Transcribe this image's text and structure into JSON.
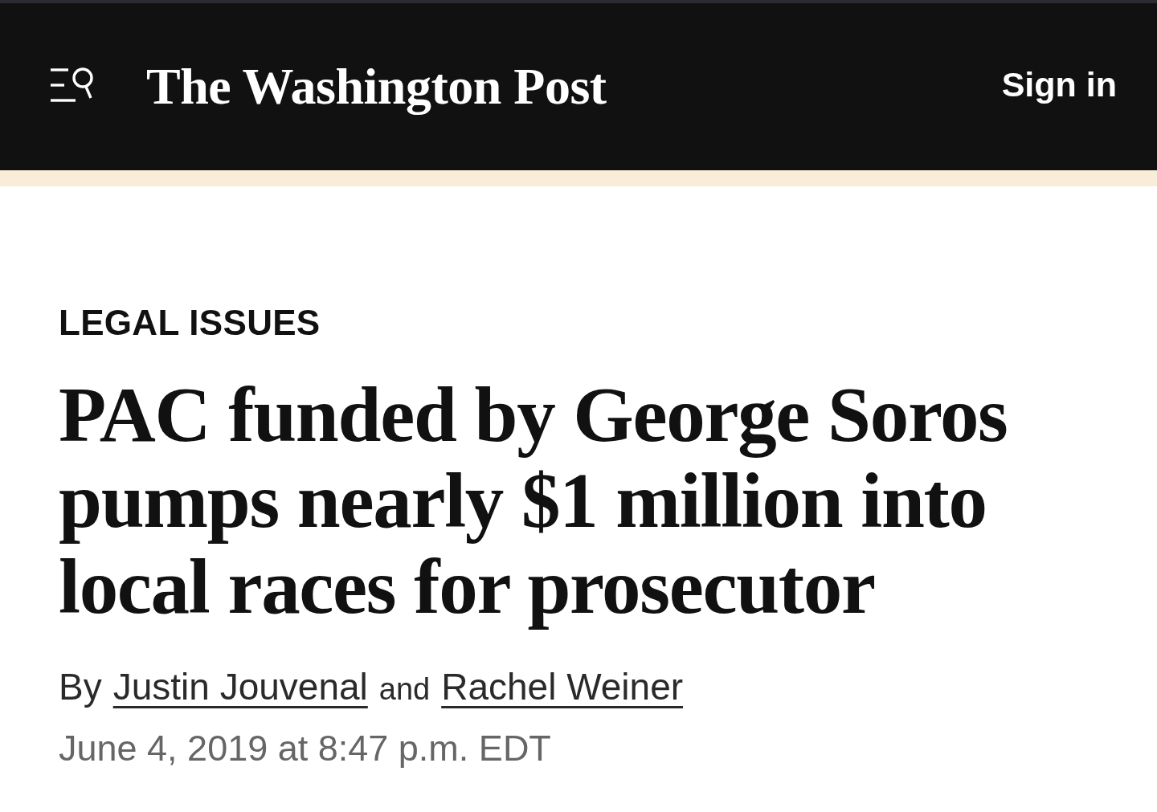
{
  "header": {
    "logo": "The Washington Post",
    "sign_in": "Sign in"
  },
  "article": {
    "section": "LEGAL ISSUES",
    "headline": "PAC funded by George Soros pumps nearly $1 million into local races for prosecutor",
    "byline": {
      "prefix": "By",
      "authors": [
        "Justin Jouvenal",
        "Rachel Weiner"
      ],
      "joiner": "and"
    },
    "timestamp": "June 4, 2019 at 8:47 p.m. EDT"
  }
}
